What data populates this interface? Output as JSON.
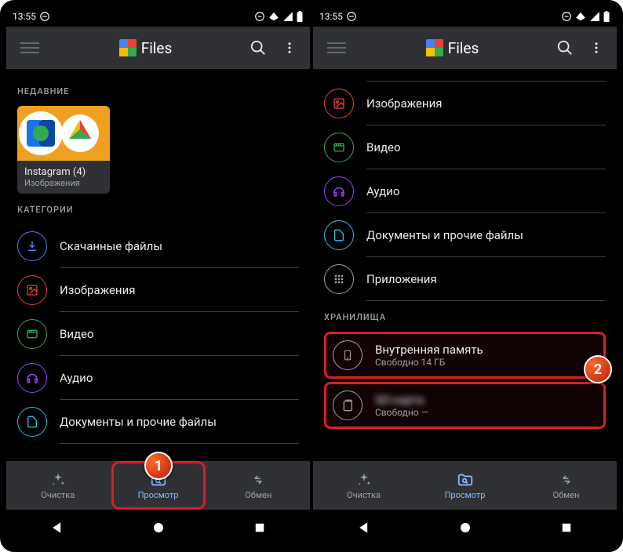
{
  "status": {
    "time": "13:55"
  },
  "app": {
    "title": "Files"
  },
  "left": {
    "section_recent": "НЕДАВНИЕ",
    "recent_tile": {
      "title": "Instagram (4)",
      "subtitle": "Изображения"
    },
    "section_categories": "КАТЕГОРИИ",
    "categories": [
      {
        "label": "Скачанные файлы",
        "color": "#4285f4"
      },
      {
        "label": "Изображения",
        "color": "#ea4335"
      },
      {
        "label": "Видео",
        "color": "#34a853"
      },
      {
        "label": "Аудио",
        "color": "#a142f4"
      },
      {
        "label": "Документы и прочие файлы",
        "color": "#24c1e0"
      }
    ]
  },
  "right": {
    "categories": [
      {
        "label": "Изображения",
        "color": "#ea4335"
      },
      {
        "label": "Видео",
        "color": "#34a853"
      },
      {
        "label": "Аудио",
        "color": "#a142f4"
      },
      {
        "label": "Документы и прочие файлы",
        "color": "#24c1e0"
      },
      {
        "label": "Приложения",
        "color": "#9aa0a6"
      }
    ],
    "section_storage": "ХРАНИЛИЩА",
    "storage": [
      {
        "label": "Внутренняя память",
        "sub": "Свободно 14 ГБ"
      },
      {
        "label": "SD-карта",
        "sub": "Свободно —"
      }
    ]
  },
  "nav": {
    "clean": "Очистка",
    "browse": "Просмотр",
    "share": "Обмен"
  },
  "callouts": {
    "one": "1",
    "two": "2"
  }
}
